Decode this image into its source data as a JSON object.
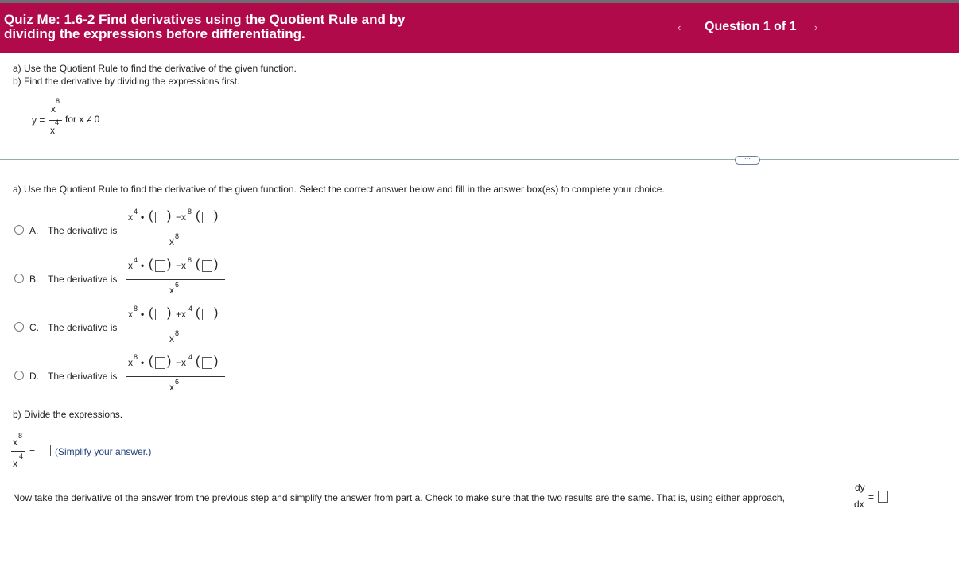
{
  "header": {
    "prefix": "Quiz Me: ",
    "title_line1": "Quiz Me: 1.6-2 Find derivatives using the Quotient Rule and by",
    "title_line2": "dividing the expressions before differentiating.",
    "question_counter": "Question 1 of 1",
    "prev_symbol": "‹",
    "next_symbol": "›"
  },
  "intro": {
    "line_a": "a) Use the Quotient Rule to find the derivative of the given function.",
    "line_b": "b) Find the derivative by dividing the expressions first."
  },
  "function": {
    "lhs": "y =",
    "numerator_base": "x",
    "numerator_exp": "8",
    "denominator_base": "x",
    "denominator_exp": "4",
    "condition": "for x ≠ 0"
  },
  "more_button": "···",
  "part_a": {
    "prompt": "a) Use the Quotient Rule to find the derivative of the given function. Select the correct answer below and fill in the answer box(es) to complete your choice.",
    "options": [
      {
        "letter": "A.",
        "text": "The derivative is",
        "e1": "4",
        "op": "−x",
        "e2": "8",
        "den": "8"
      },
      {
        "letter": "B.",
        "text": "The derivative is",
        "e1": "4",
        "op": "−x",
        "e2": "8",
        "den": "6"
      },
      {
        "letter": "C.",
        "text": "The derivative is",
        "e1": "8",
        "op": "+x",
        "e2": "4",
        "den": "8"
      },
      {
        "letter": "D.",
        "text": "The derivative is",
        "e1": "8",
        "op": "−x",
        "e2": "4",
        "den": "6"
      }
    ]
  },
  "part_b": {
    "prompt": "b) Divide the expressions.",
    "num_exp": "8",
    "den_exp": "4",
    "equals": "=",
    "hint": "(Simplify your answer.)",
    "final_text": "Now take the derivative of the answer from the previous step and simplify the answer from part a. Check to make sure that the two results are the same. That is, using either approach,",
    "dy": "dy",
    "dx": "dx"
  }
}
